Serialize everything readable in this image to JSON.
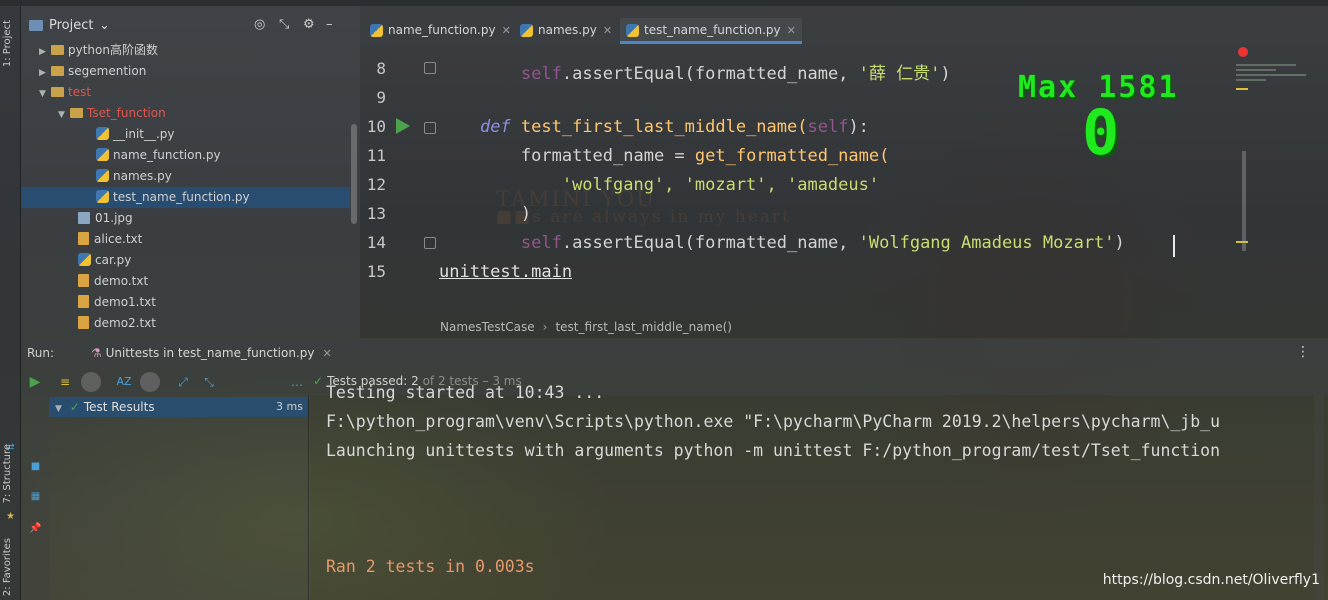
{
  "project_panel": {
    "title": "Project",
    "tree": [
      {
        "label": "python高阶函数",
        "type": "folder",
        "arrow": "▶"
      },
      {
        "label": "segemention",
        "type": "folder",
        "arrow": "▶"
      },
      {
        "label": "test",
        "type": "folder",
        "arrow": "▼"
      },
      {
        "label": "Tset_function",
        "type": "folder",
        "arrow": "▼"
      },
      {
        "label": "__init__.py",
        "type": "py"
      },
      {
        "label": "name_function.py",
        "type": "py"
      },
      {
        "label": "names.py",
        "type": "py"
      },
      {
        "label": "test_name_function.py",
        "type": "py",
        "selected": true
      },
      {
        "label": "01.jpg",
        "type": "jpg"
      },
      {
        "label": "alice.txt",
        "type": "txt"
      },
      {
        "label": "car.py",
        "type": "py"
      },
      {
        "label": "demo.txt",
        "type": "txt"
      },
      {
        "label": "demo1.txt",
        "type": "txt"
      },
      {
        "label": "demo2.txt",
        "type": "txt"
      }
    ]
  },
  "side_strip": {
    "project_label": "1: Project",
    "structure_label": "7: Structure",
    "favorites_label": "2: Favorites"
  },
  "editor": {
    "tabs": [
      {
        "label": "name_function.py"
      },
      {
        "label": "names.py"
      },
      {
        "label": "test_name_function.py",
        "active": true
      }
    ],
    "line_numbers": [
      "8",
      "9",
      "10",
      "11",
      "12",
      "13",
      "14",
      "15"
    ],
    "code": {
      "l8_self": "self",
      "l8_call": ".assertEqual(formatted_name, ",
      "l8_str": "'薛 仁贵'",
      "l8_end": ")",
      "l10_def": "def",
      "l10_name": " test_first_last_middle_name(",
      "l10_self": "self",
      "l10_end": "):",
      "l11_var": "formatted_name = ",
      "l11_fn": "get_formatted_name(",
      "l12_args": "'wolfgang', 'mozart', 'amadeus'",
      "l13": ")",
      "l14_self": "self",
      "l14_call": ".assertEqual(formatted_name, ",
      "l14_str": "'Wolfgang Amadeus Mozart'",
      "l14_end": ")",
      "l15": "unittest.main"
    },
    "breadcrumb": [
      "NamesTestCase",
      "test_first_last_middle_name()"
    ]
  },
  "overlay": {
    "score_text": "Max 1581",
    "score_value": "0",
    "bg_text_1": "TAMINI YOU",
    "bg_text_2": "■■s are always in my heart"
  },
  "run_window": {
    "label": "Run:",
    "tab_label": "Unittests in test_name_function.py",
    "tests_passed": "Tests passed: 2",
    "tests_detail": "of 2 tests – 3 ms",
    "test_results": {
      "label": "Test Results",
      "time": "3 ms"
    },
    "console_lines": [
      "Testing started at 10:43 ...",
      "F:\\python_program\\venv\\Scripts\\python.exe \"F:\\pycharm\\PyCharm 2019.2\\helpers\\pycharm\\_jb_u",
      "Launching unittests with arguments python -m unittest F:/python_program/test/Tset_function"
    ],
    "result_line": "Ran 2 tests in 0.003s"
  },
  "watermark": "https://blog.csdn.net/Oliverfly1"
}
